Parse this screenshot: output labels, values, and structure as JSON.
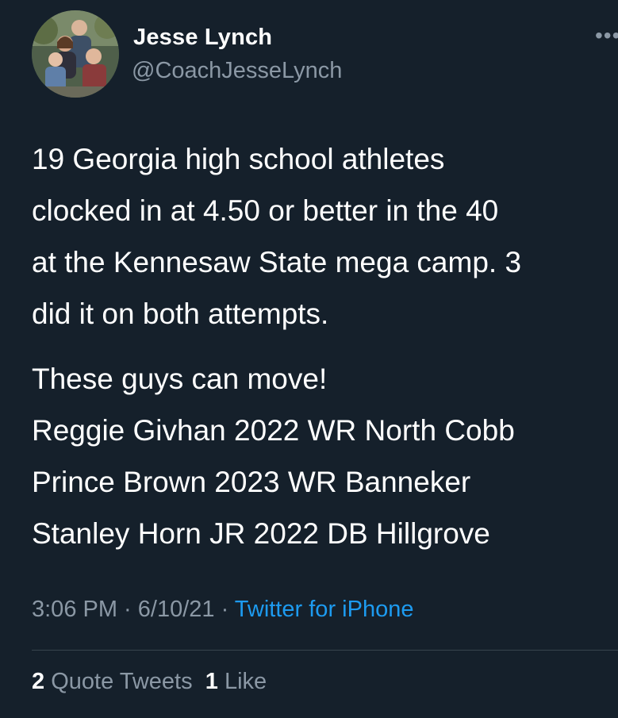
{
  "author": {
    "name": "Jesse Lynch",
    "handle": "@CoachJesseLynch",
    "avatar_icon": "family-photo-avatar"
  },
  "menu": {
    "more_icon": "more-horizontal-icon",
    "glyph": "•••"
  },
  "tweet": {
    "paragraph1": [
      "19 Georgia high school athletes",
      "clocked in at 4.50 or better in the 40",
      "at the Kennesaw State mega camp. 3",
      "did it on both attempts."
    ],
    "paragraph2": [
      "These guys can move!",
      "Reggie Givhan 2022 WR North Cobb",
      "Prince Brown 2023 WR Banneker",
      "Stanley Horn JR 2022 DB Hillgrove"
    ]
  },
  "meta": {
    "time": "3:06 PM",
    "separator": " · ",
    "date": "6/10/21",
    "source": "Twitter for iPhone"
  },
  "stats": {
    "quote_count": "2",
    "quote_label": "Quote Tweets",
    "like_count": "1",
    "like_label": "Like"
  },
  "colors": {
    "background": "#15202b",
    "text": "#ffffff",
    "secondary": "#8b98a5",
    "link": "#1d9bf0",
    "divider": "#38444d"
  }
}
